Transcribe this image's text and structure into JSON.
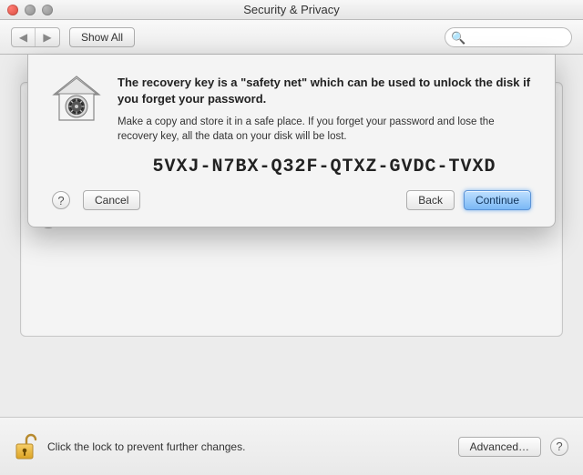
{
  "window": {
    "title": "Security & Privacy"
  },
  "toolbar": {
    "show_all_label": "Show All",
    "search_placeholder": ""
  },
  "sheet": {
    "heading": "The recovery key is a \"safety net\" which can be used to unlock the disk if you forget your password.",
    "body": "Make a copy and store it in a safe place. If you forget your password and lose the recovery key, all the data on your disk will be lost.",
    "recovery_key": "5VXJ-N7BX-Q32F-QTXZ-GVDC-TVXD",
    "cancel_label": "Cancel",
    "back_label": "Back",
    "continue_label": "Continue"
  },
  "bottom": {
    "lock_message": "Click the lock to prevent further changes.",
    "advanced_label": "Advanced…"
  },
  "icons": {
    "help_glyph": "?",
    "back_glyph": "◀",
    "forward_glyph": "▶",
    "search_glyph": "🔍"
  }
}
